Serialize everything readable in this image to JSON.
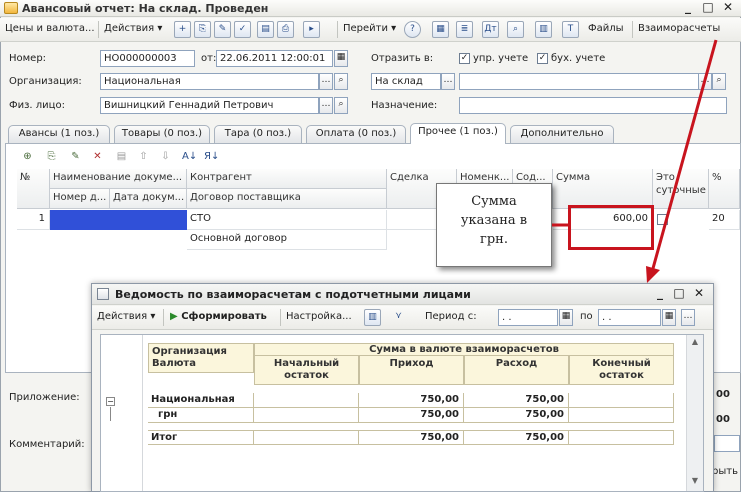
{
  "window": {
    "title": "Авансовый отчет: На склад. Проведен"
  },
  "toolbar": {
    "prices_currency": "Цены и валюта...",
    "actions": "Действия",
    "goto": "Перейти",
    "files": "Файлы",
    "settlements": "Взаиморасчеты"
  },
  "header": {
    "number_label": "Номер:",
    "number_value": "НО000000003",
    "date_label": "от:",
    "date_value": "22.06.2011 12:00:01",
    "reflect_label": "Отразить в:",
    "mgmt_label": "упр. учете",
    "acct_label": "бух. учете",
    "org_label": "Организация:",
    "org_value": "Национальная",
    "warehouse_value": "На склад",
    "person_label": "Физ. лицо:",
    "person_value": "Вишницкий Геннадий Петрович",
    "purpose_label": "Назначение:"
  },
  "tabs": [
    "Авансы (1 поз.)",
    "Товары (0 поз.)",
    "Тара (0 поз.)",
    "Оплата (0 поз.)",
    "Прочее (1 поз.)",
    "Дополнительно"
  ],
  "grid": {
    "headers": [
      "№",
      "Наименование докуме...",
      "Контрагент",
      "Сделка",
      "Номенк...",
      "Сод...",
      "Сумма",
      "Это суточные",
      "%"
    ],
    "subheaders": [
      "Номер д...",
      "Дата докум...",
      "Договор поставщика"
    ],
    "row": {
      "n": "1",
      "contractor": "СТО",
      "contract": "Основной договор",
      "amount": "600,00",
      "pct": "20"
    }
  },
  "callout": {
    "line1": "Сумма",
    "line2": "указана в",
    "line3": "грн."
  },
  "bottom": {
    "attachment_label": "Приложение:",
    "comment_label": "Комментарий:",
    "right_edge_1": "00",
    "right_edge_2": "00",
    "right_close": "рыть"
  },
  "report": {
    "title": "Ведомость по взаиморасчетам с подотчетными лицами",
    "actions": "Действия",
    "generate": "Сформировать",
    "settings": "Настройка...",
    "period_label": "Период с:",
    "period_from": ". .",
    "to_label": "по",
    "period_to": ". .",
    "col_org": "Организация",
    "col_currency": "Валюта",
    "col_amount_group": "Сумма в валюте взаиморасчетов",
    "col_opening": "Начальный остаток",
    "col_income": "Приход",
    "col_expense": "Расход",
    "col_closing": "Конечный остаток",
    "rows": [
      {
        "name": "Национальная",
        "opening": "",
        "income": "750,00",
        "expense": "750,00",
        "closing": ""
      },
      {
        "name": "грн",
        "opening": "",
        "income": "750,00",
        "expense": "750,00",
        "closing": ""
      },
      {
        "name": "Итог",
        "opening": "",
        "income": "750,00",
        "expense": "750,00",
        "closing": ""
      }
    ]
  },
  "colors": {
    "accent_red": "#c8141e",
    "selection_blue": "#3050d8",
    "report_header_bg": "#fbf6dc"
  }
}
